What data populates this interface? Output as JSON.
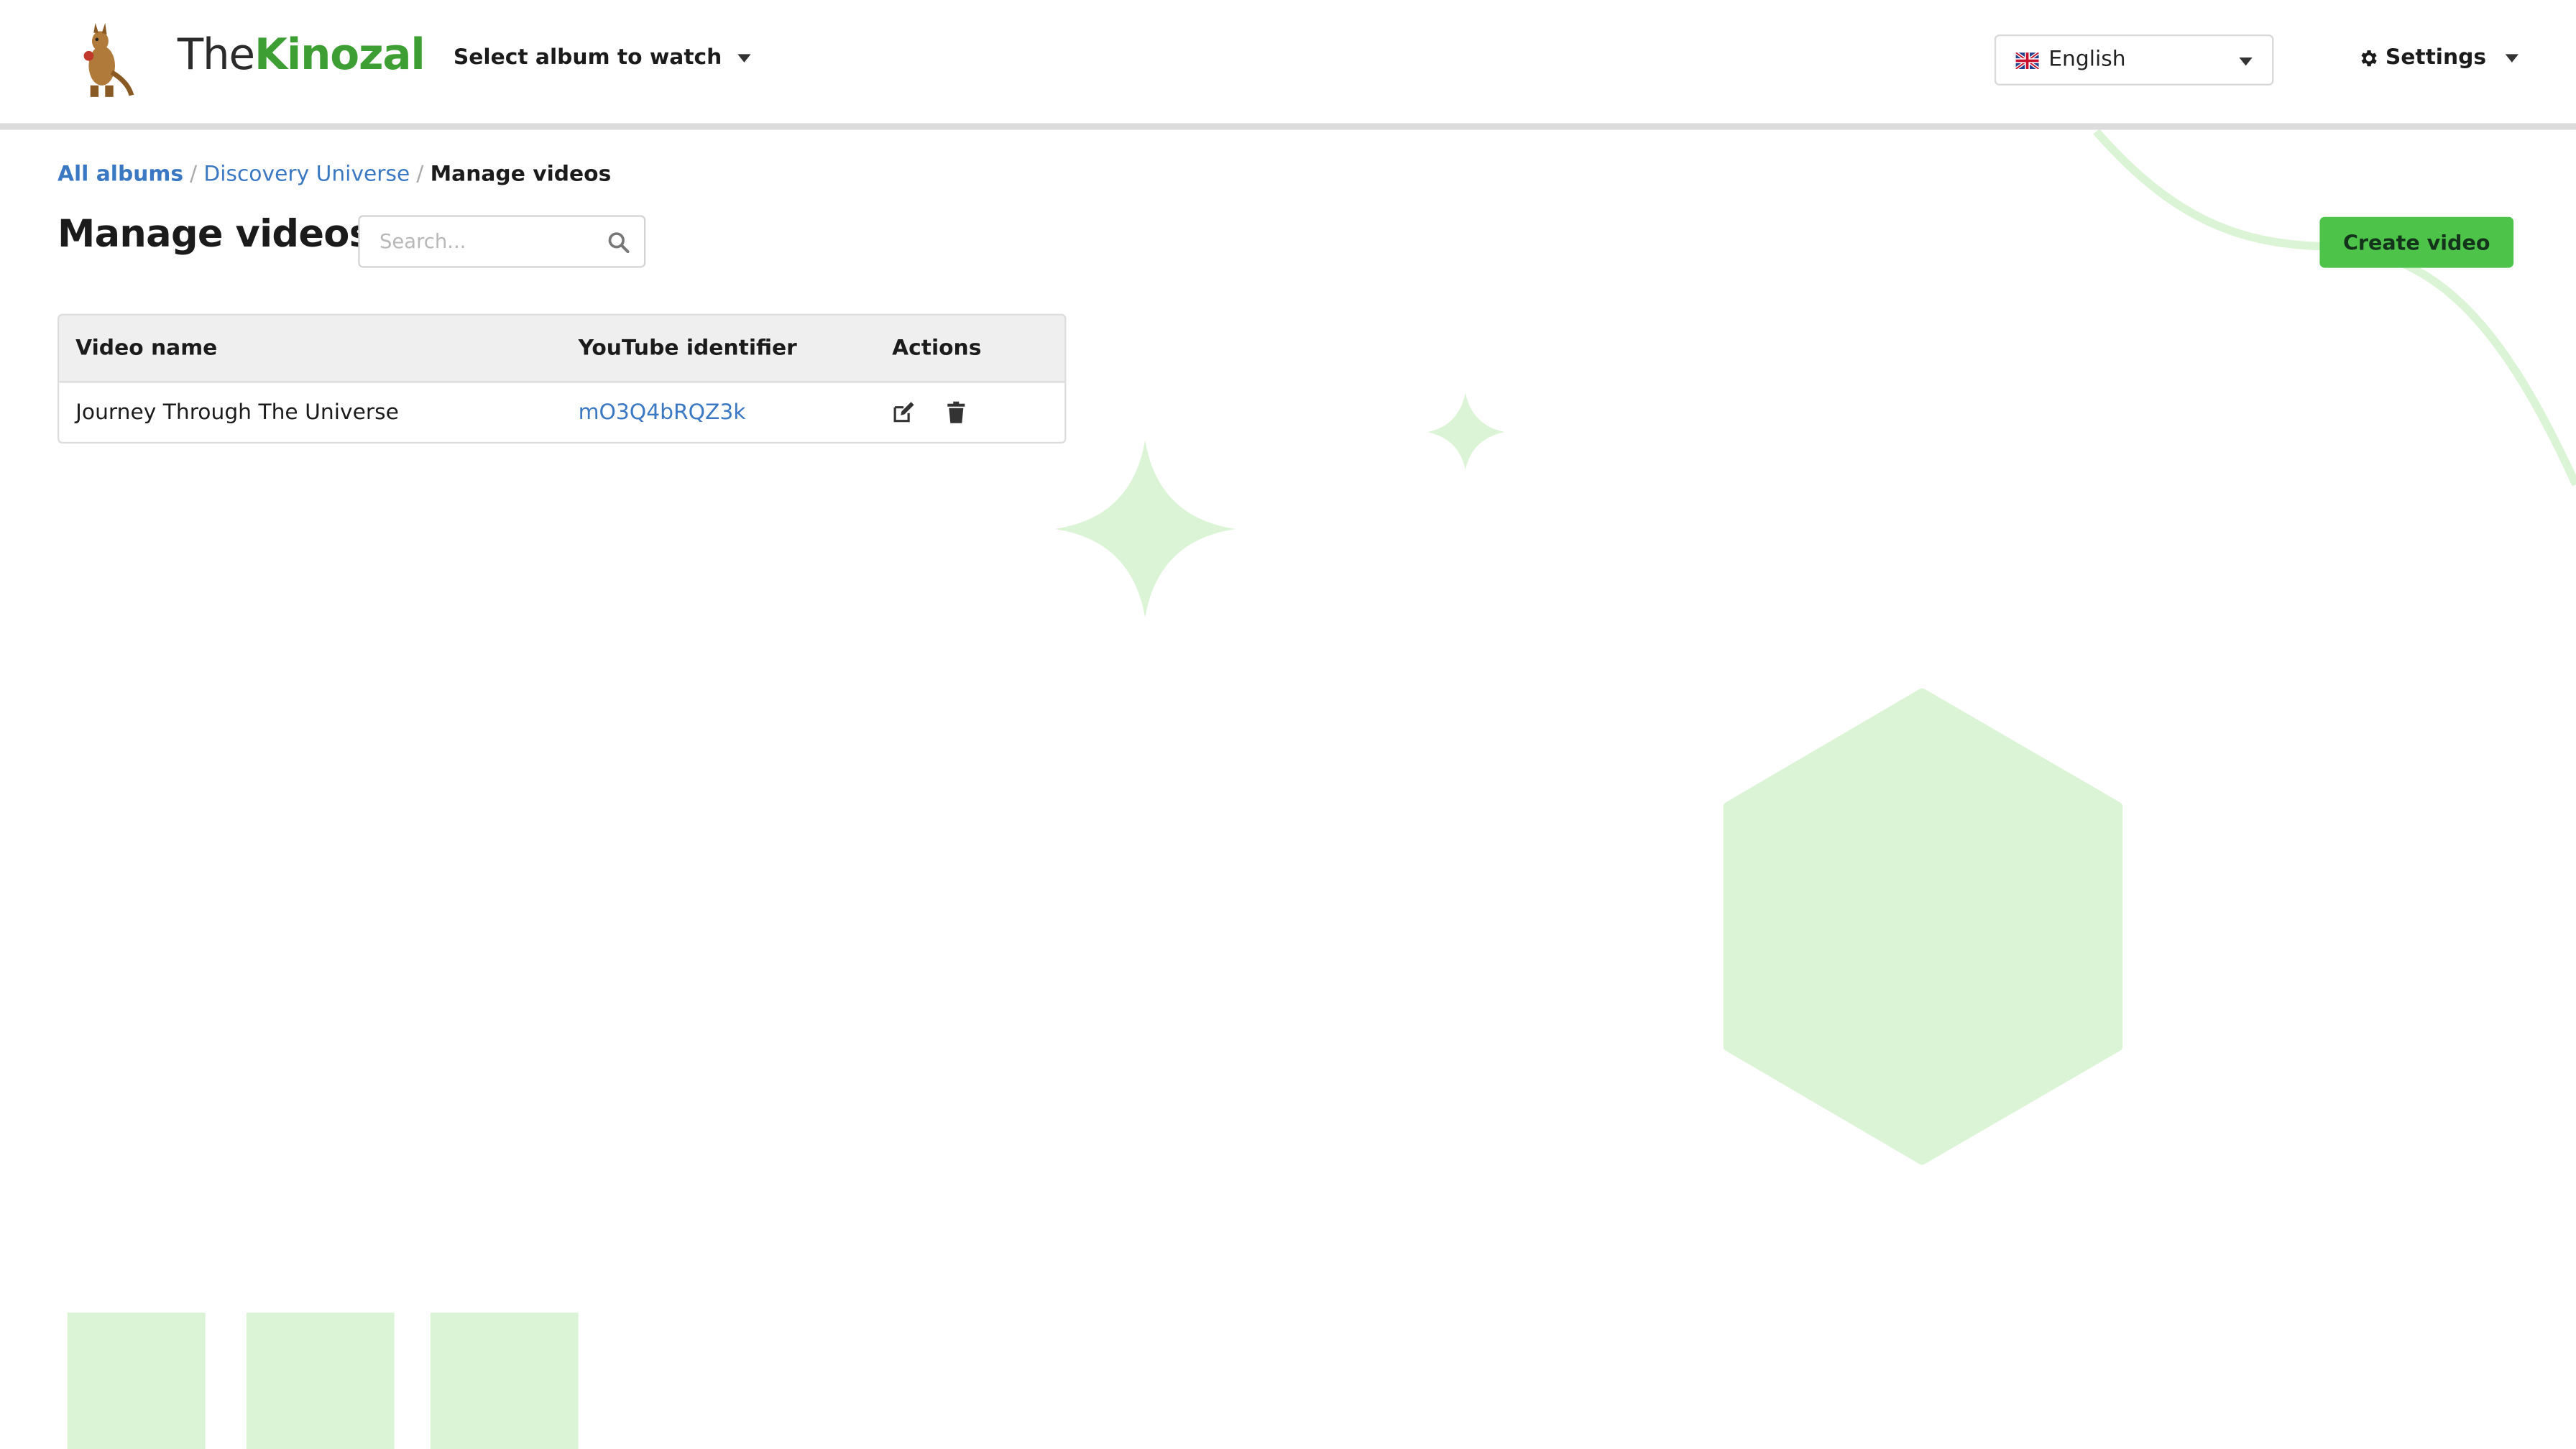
{
  "header": {
    "logo_icon": "kangaroo-logo-icon",
    "brand": {
      "prefix": "The",
      "highlight": "Kinozal"
    },
    "album_select_label": "Select album to watch",
    "language": {
      "selected": "English",
      "flag_icon": "uk-flag-icon"
    },
    "settings_label": "Settings",
    "settings_icon": "gear-icon"
  },
  "breadcrumb": {
    "items": [
      "All albums",
      "Discovery Universe",
      "Manage videos"
    ],
    "separator": "/"
  },
  "main": {
    "title": "Manage videos",
    "search": {
      "placeholder": "Search...",
      "value": "",
      "icon": "search-icon"
    },
    "create_button_label": "Create video"
  },
  "table": {
    "columns": [
      "Video name",
      "YouTube identifier",
      "Actions"
    ],
    "rows": [
      {
        "name": "Journey Through The Universe",
        "youtube_id": "mO3Q4bRQZ3k",
        "actions": [
          "edit-icon",
          "trash-icon"
        ]
      }
    ]
  },
  "colors": {
    "brand_green": "#3d9e33",
    "button_green": "#4dc34a",
    "link_blue": "#3a78c3",
    "decor_green": "#dbf4d6"
  }
}
